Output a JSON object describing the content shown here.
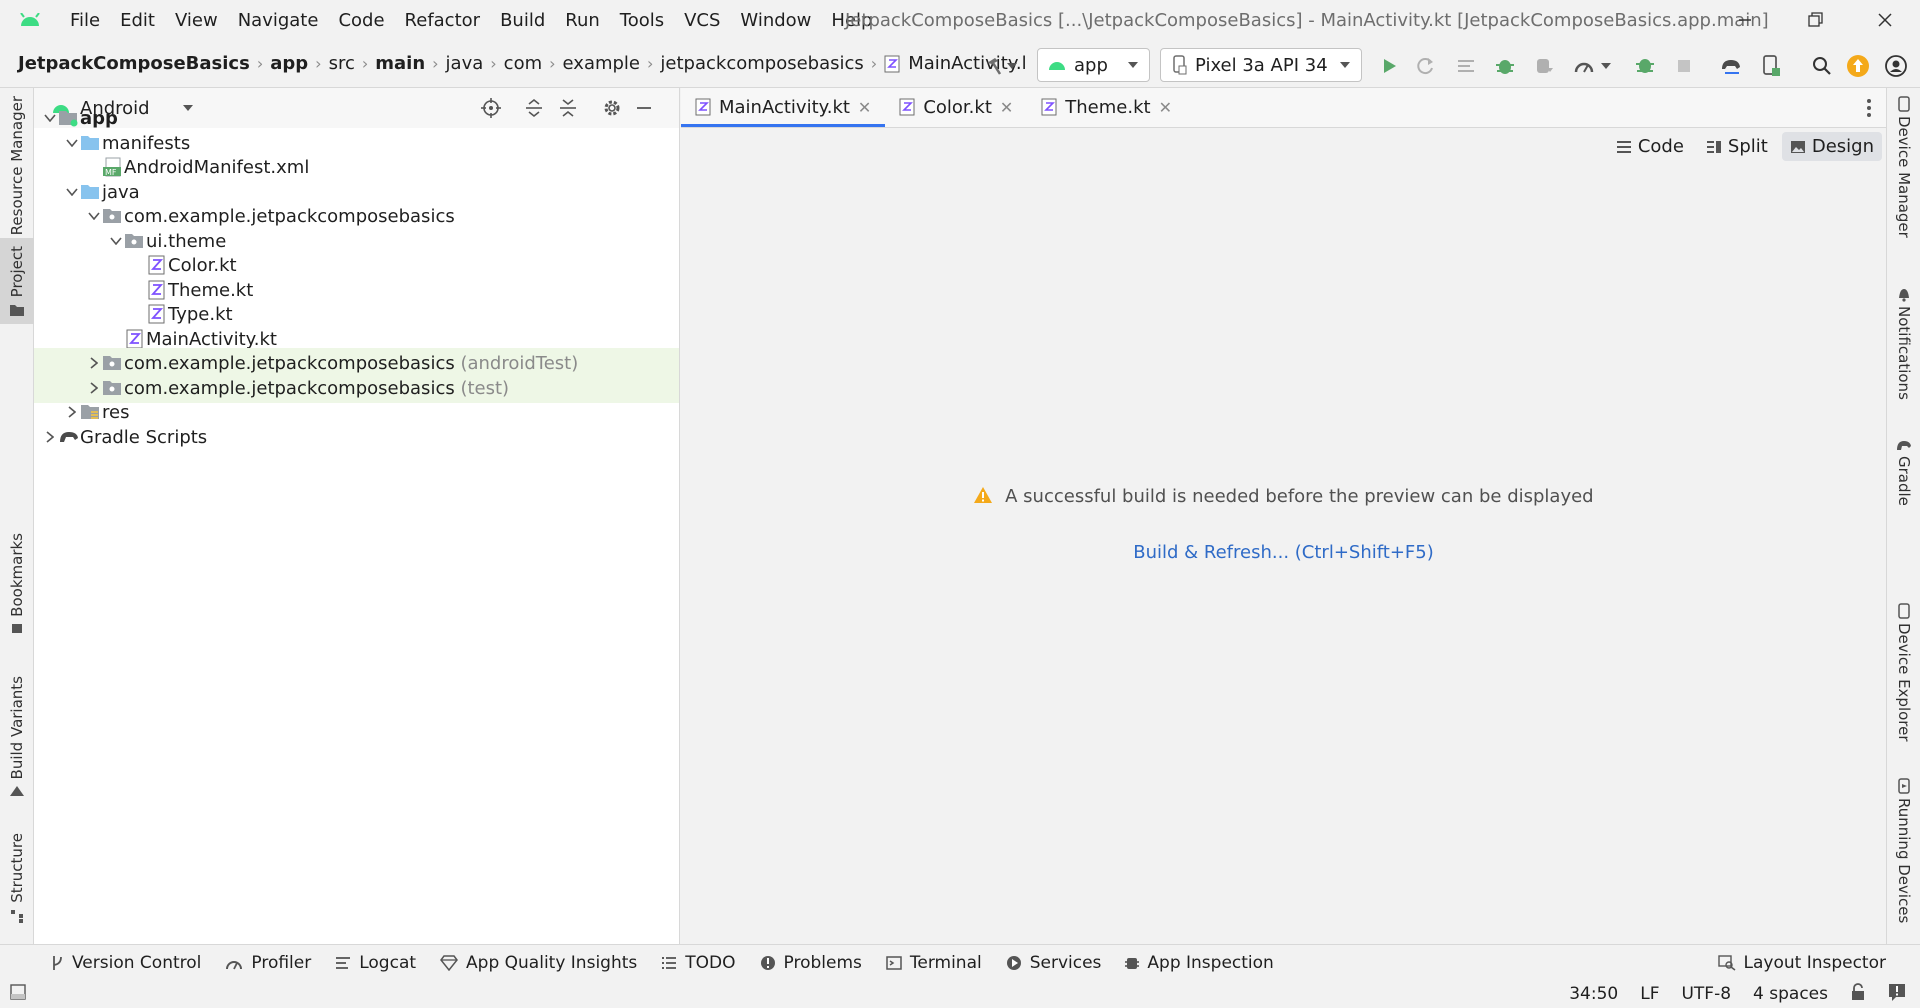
{
  "menu": [
    "File",
    "Edit",
    "View",
    "Navigate",
    "Code",
    "Refactor",
    "Build",
    "Run",
    "Tools",
    "VCS",
    "Window",
    "Help"
  ],
  "window_title": "JetpackComposeBasics [...\\JetpackComposeBasics] - MainActivity.kt [JetpackComposeBasics.app.main]",
  "breadcrumb": [
    "JetpackComposeBasics",
    "app",
    "src",
    "main",
    "java",
    "com",
    "example",
    "jetpackcomposebasics",
    "MainActivity.l"
  ],
  "run_config": "app",
  "device": "Pixel 3a API 34",
  "project_view": "Android",
  "tree": [
    {
      "label": "app"
    },
    {
      "label": "manifests"
    },
    {
      "label": "AndroidManifest.xml"
    },
    {
      "label": "java"
    },
    {
      "label": "com.example.jetpackcomposebasics"
    },
    {
      "label": "ui.theme"
    },
    {
      "label": "Color.kt"
    },
    {
      "label": "Theme.kt"
    },
    {
      "label": "Type.kt"
    },
    {
      "label": "MainActivity.kt"
    },
    {
      "label": "com.example.jetpackcomposebasics",
      "suffix": "(androidTest)"
    },
    {
      "label": "com.example.jetpackcomposebasics",
      "suffix": "(test)"
    },
    {
      "label": "res"
    },
    {
      "label": "Gradle Scripts"
    }
  ],
  "editor_tabs": [
    "MainActivity.kt",
    "Color.kt",
    "Theme.kt"
  ],
  "view_modes": [
    "Code",
    "Split",
    "Design"
  ],
  "preview_message": "A successful build is needed before the preview can be displayed",
  "build_link": "Build & Refresh... (Ctrl+Shift+F5)",
  "left_tabs": [
    "Resource Manager",
    "Project",
    "Bookmarks",
    "Build Variants",
    "Structure"
  ],
  "right_tabs": [
    "Device Manager",
    "Notifications",
    "Gradle",
    "Device Explorer",
    "Running Devices"
  ],
  "bottom_tools": [
    "Version Control",
    "Profiler",
    "Logcat",
    "App Quality Insights",
    "TODO",
    "Problems",
    "Terminal",
    "Services",
    "App Inspection"
  ],
  "layout_inspector": "Layout Inspector",
  "status": {
    "position": "34:50",
    "line_sep": "LF",
    "encoding": "UTF-8",
    "indent": "4 spaces"
  },
  "colors": {
    "accent": "#3574f0",
    "android_green": "#3ddc84",
    "link": "#2f6bc7",
    "highlight": "#eef7e6",
    "run_green": "#59a869",
    "update": "#f4a91a"
  }
}
